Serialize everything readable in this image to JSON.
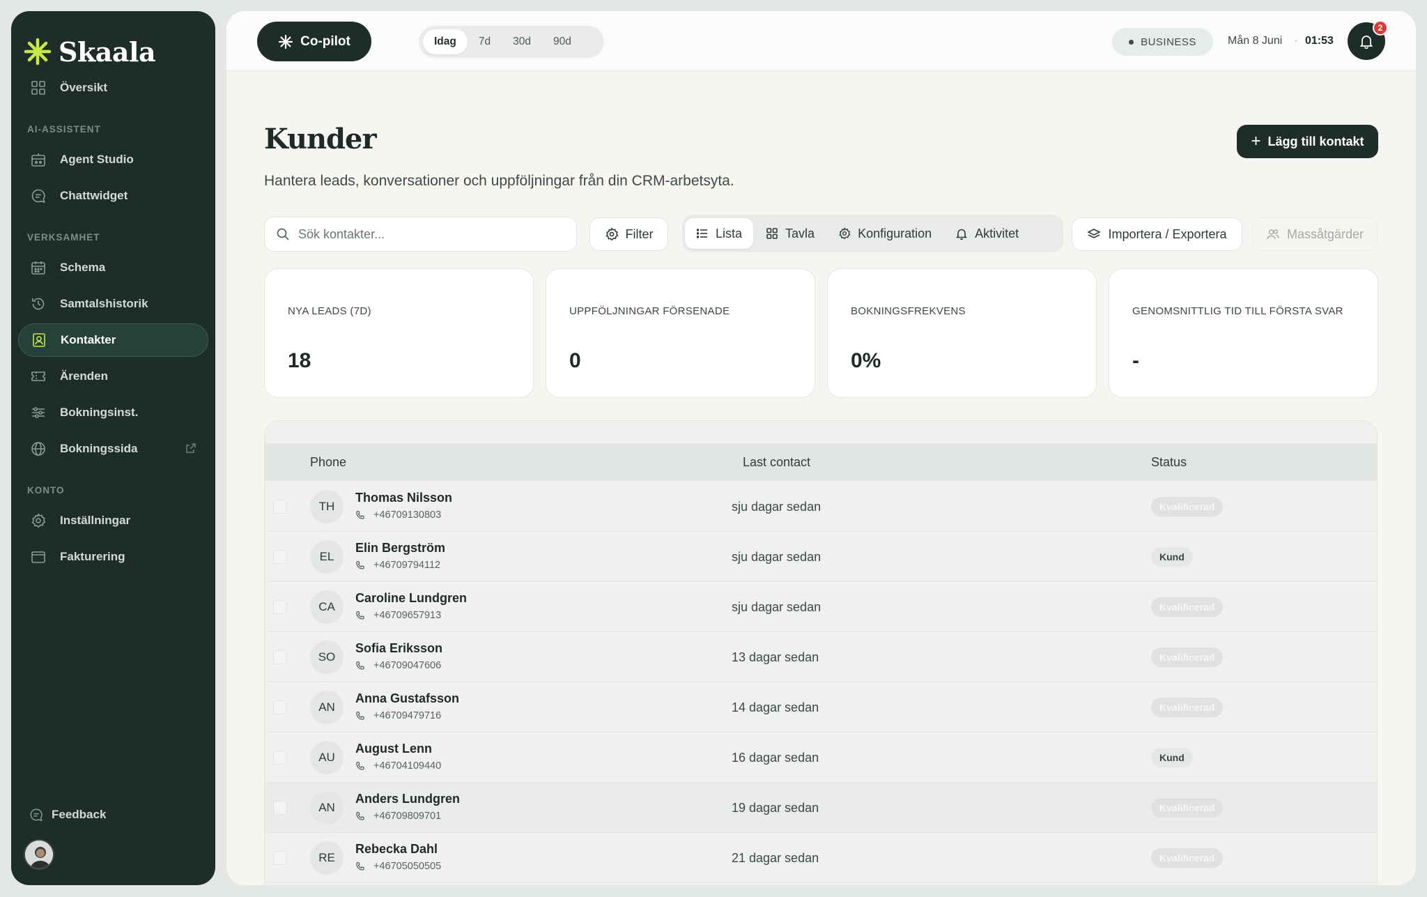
{
  "brand": {
    "name": "Skaala"
  },
  "sidebar": {
    "overview": "Översikt",
    "sections": {
      "ai": "AI-ASSISTENT",
      "business": "VERKSAMHET",
      "account": "KONTO"
    },
    "ai_items": [
      "Agent Studio",
      "Chattwidget"
    ],
    "business_items": [
      "Schema",
      "Samtalshistorik",
      "Kontakter",
      "Ärenden",
      "Bokningsinst.",
      "Bokningssida"
    ],
    "account_items": [
      "Inställningar",
      "Fakturering"
    ],
    "active_item": "Kontakter",
    "feedback": "Feedback"
  },
  "topbar": {
    "copilot": "Co-pilot",
    "ranges": [
      "Idag",
      "7d",
      "30d",
      "90d"
    ],
    "active_range": "Idag",
    "plan": "BUSINESS",
    "date": "Mån 8 Juni",
    "separator": "·",
    "time": "01:53",
    "notifications": "2"
  },
  "page": {
    "title": "Kunder",
    "subtitle": "Hantera leads, konversationer och uppföljningar från din CRM-arbetsyta.",
    "add_button": "Lägg till kontakt"
  },
  "toolbar": {
    "search_placeholder": "Sök kontakter...",
    "filter": "Filter",
    "views": [
      "Lista",
      "Tavla",
      "Konfiguration",
      "Aktivitet"
    ],
    "active_view": "Lista",
    "import_export": "Importera / Exportera",
    "bulk": "Massåtgärder"
  },
  "stats": [
    {
      "label": "NYA LEADS (7D)",
      "value": "18"
    },
    {
      "label": "UPPFÖLJNINGAR FÖRSENADE",
      "value": "0"
    },
    {
      "label": "BOKNINGSFREKVENS",
      "value": "0%"
    },
    {
      "label": "GENOMSNITTLIG TID TILL FÖRSTA SVAR",
      "value": "-"
    }
  ],
  "table": {
    "columns": [
      "Phone",
      "Last contact",
      "Status"
    ],
    "rows": [
      {
        "initials": "TH",
        "name": "Thomas Nilsson",
        "phone": "+46709130803",
        "last": "sju dagar sedan",
        "status": "Kvalificerad"
      },
      {
        "initials": "EL",
        "name": "Elin Bergström",
        "phone": "+46709794112",
        "last": "sju dagar sedan",
        "status": "Kund"
      },
      {
        "initials": "CA",
        "name": "Caroline Lundgren",
        "phone": "+46709657913",
        "last": "sju dagar sedan",
        "status": "Kvalificerad"
      },
      {
        "initials": "SO",
        "name": "Sofia Eriksson",
        "phone": "+46709047606",
        "last": "13 dagar sedan",
        "status": "Kvalificerad"
      },
      {
        "initials": "AN",
        "name": "Anna Gustafsson",
        "phone": "+46709479716",
        "last": "14 dagar sedan",
        "status": "Kvalificerad"
      },
      {
        "initials": "AU",
        "name": "August Lenn",
        "phone": "+46704109440",
        "last": "16 dagar sedan",
        "status": "Kund"
      },
      {
        "initials": "AN",
        "name": "Anders Lundgren",
        "phone": "+46709809701",
        "last": "19 dagar sedan",
        "status": "Kvalificerad"
      },
      {
        "initials": "RE",
        "name": "Rebecka Dahl",
        "phone": "+46705050505",
        "last": "21 dagar sedan",
        "status": "Kvalificerad"
      }
    ]
  },
  "colors": {
    "sidebar": "#1f2d2a",
    "accent": "#c8e84a",
    "badge_alert": "#d93b3b"
  }
}
